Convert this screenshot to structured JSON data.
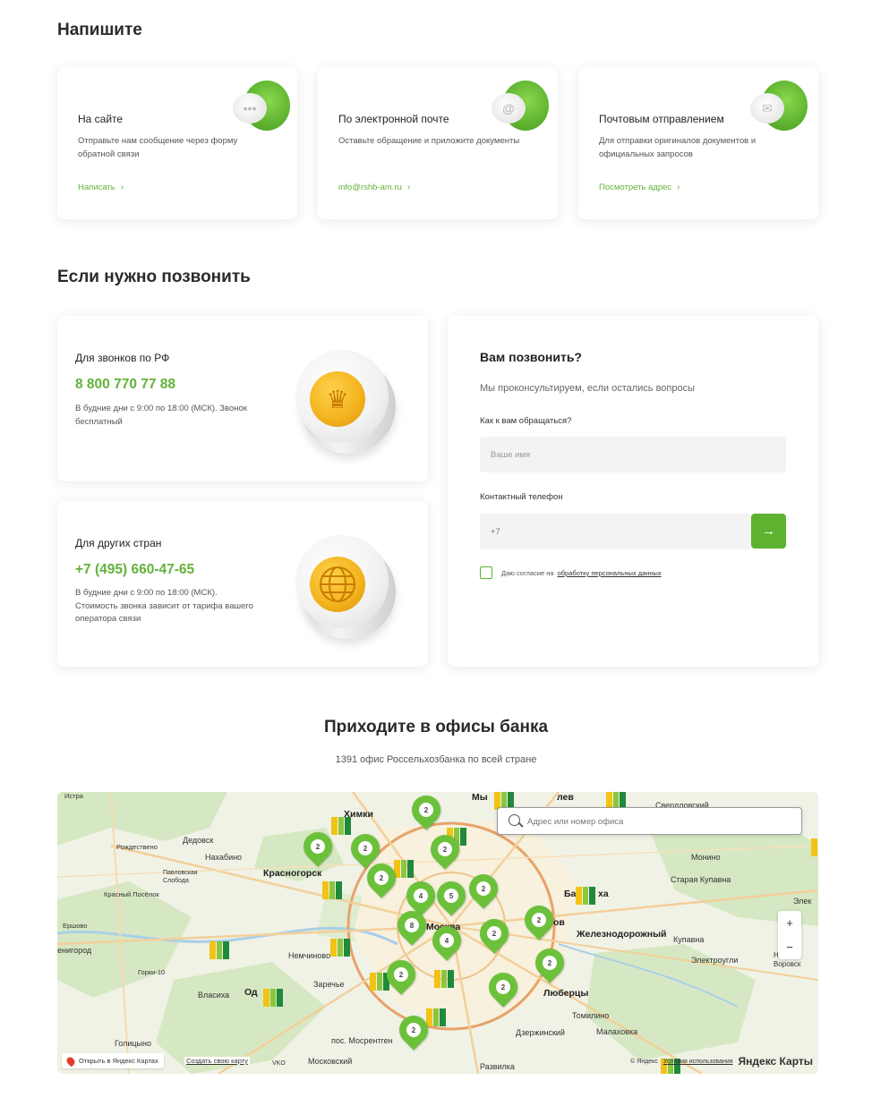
{
  "write": {
    "title": "Напишите",
    "cards": [
      {
        "title": "На сайте",
        "desc": "Отправьте нам сообщение через форму обратной связи",
        "link": "Написать",
        "icon": "chat-bubble-icon"
      },
      {
        "title": "По электронной почте",
        "desc": "Оставьте обращение и приложите документы",
        "link": "info@rshb-am.ru",
        "icon": "at-sign-icon"
      },
      {
        "title": "Почтовым отправлением",
        "desc": "Для отправки оригиналов документов и официальных запросов",
        "link": "Посмотреть адрес",
        "icon": "envelope-icon"
      }
    ]
  },
  "call": {
    "title": "Если нужно позвонить",
    "cards": [
      {
        "title": "Для звонков по РФ",
        "phone": "8 800 770 77 88",
        "desc": "В будние дни с 9:00 по 18:00 (МСК). Звонок бесплатный",
        "icon": "coat-of-arms-icon"
      },
      {
        "title": "Для других стран",
        "phone": "+7 (495) 660-47-65",
        "desc": "В будние дни с 9:00 по 18:00 (МСК). Стоимость звонка зависит от тарифа вашего оператора связи",
        "icon": "globe-icon"
      }
    ]
  },
  "callback": {
    "title": "Вам позвонить?",
    "subtitle": "Мы проконсультируем, если остались вопросы",
    "name_label": "Как к вам обращаться?",
    "name_placeholder": "Ваше имя",
    "phone_label": "Контактный телефон",
    "phone_value": "+7",
    "consent_text": "Даю согласие на",
    "consent_link": "обработку персональных данных",
    "accent": "#5db22f"
  },
  "offices": {
    "title": "Приходите в офисы банка",
    "subtitle": "1391 офис Россельхозбанка по всей стране",
    "search_placeholder": "Адрес или номер офиса",
    "zoom_in": "+",
    "zoom_out": "−",
    "open_in_yandex": "Открыть в Яндекс Картах",
    "create_map": "Создать свою карту",
    "copyright": "© Яндекс",
    "terms": "Условия использования",
    "brand": "Яндекс Карты",
    "labels": {
      "dedovsk": "Дедовск",
      "nakhabino": "Нахабино",
      "krasnogorsk": "Красногорск",
      "pavlovskaya": "Павловская Слобода",
      "rozhdestveno": "Рождествено",
      "krasny_poselok": "Красный Посёлок",
      "nemchinovo": "Немчиново",
      "gorki10": "Горки-10",
      "vlasikha": "Власиха",
      "odintsovo": "Од",
      "zarechye": "Заречье",
      "golitsyno": "Голицыно",
      "mosrentgen": "пос. Мосрентген",
      "moskovsky": "Московский",
      "moscow": "Москва",
      "zheleznodorozhny": "Железнодорожный",
      "kupavna": "Купавна",
      "staraya_kupavna": "Старая Купавна",
      "monino": "Монино",
      "elektrougli": "Электроугли",
      "lyubertsy": "Люберцы",
      "tomilino": "Томилино",
      "malakhovka": "Малаховка",
      "dzerzhinsky": "Дзержинский",
      "razvilka": "Развилка",
      "sverdlovsky": "Свердловский",
      "khimki": "Химки",
      "mytishchi": "Мы",
      "korolev": "лев",
      "balashikha": "Ба",
      "balashikha2": "ха",
      "ov": "ов",
      "elektrostal": "Элек",
      "voskresensk": "Воровск",
      "zvenigorod": "енигород",
      "ershovo": "Ершово",
      "istra": "Истра",
      "vnukovo": "VKO",
      "noginsk": "Ногинск"
    },
    "pins": [
      "2",
      "2",
      "2",
      "2",
      "2",
      "4",
      "5",
      "2",
      "2",
      "8",
      "4",
      "2",
      "2",
      "2",
      "2",
      "2",
      "2"
    ]
  }
}
